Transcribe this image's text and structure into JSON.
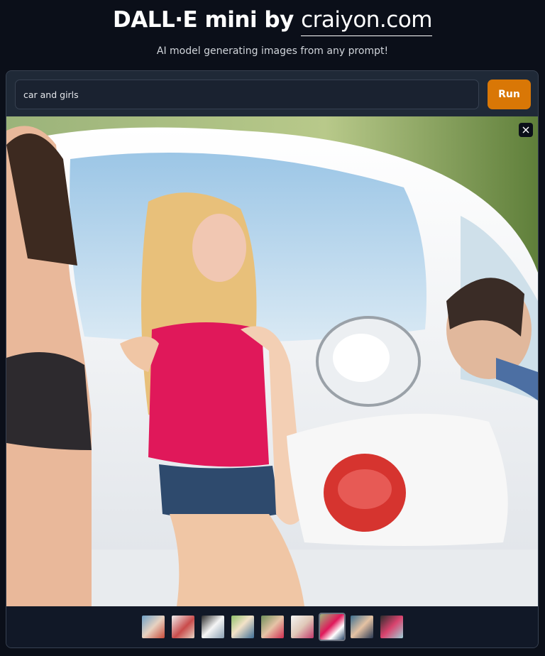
{
  "header": {
    "title_main": "DALL·E mini by ",
    "title_link": "craiyon.com",
    "subtitle": "AI model generating images from any prompt!"
  },
  "prompt": {
    "value": "car and girls"
  },
  "run_button": {
    "label": "Run",
    "color": "#d97706"
  },
  "gallery": {
    "close_icon": "close-icon",
    "thumbnail_count": 9,
    "selected_index": 6
  },
  "colors": {
    "background": "#0b0f19",
    "panel": "#1f2937",
    "accent": "#d97706"
  }
}
